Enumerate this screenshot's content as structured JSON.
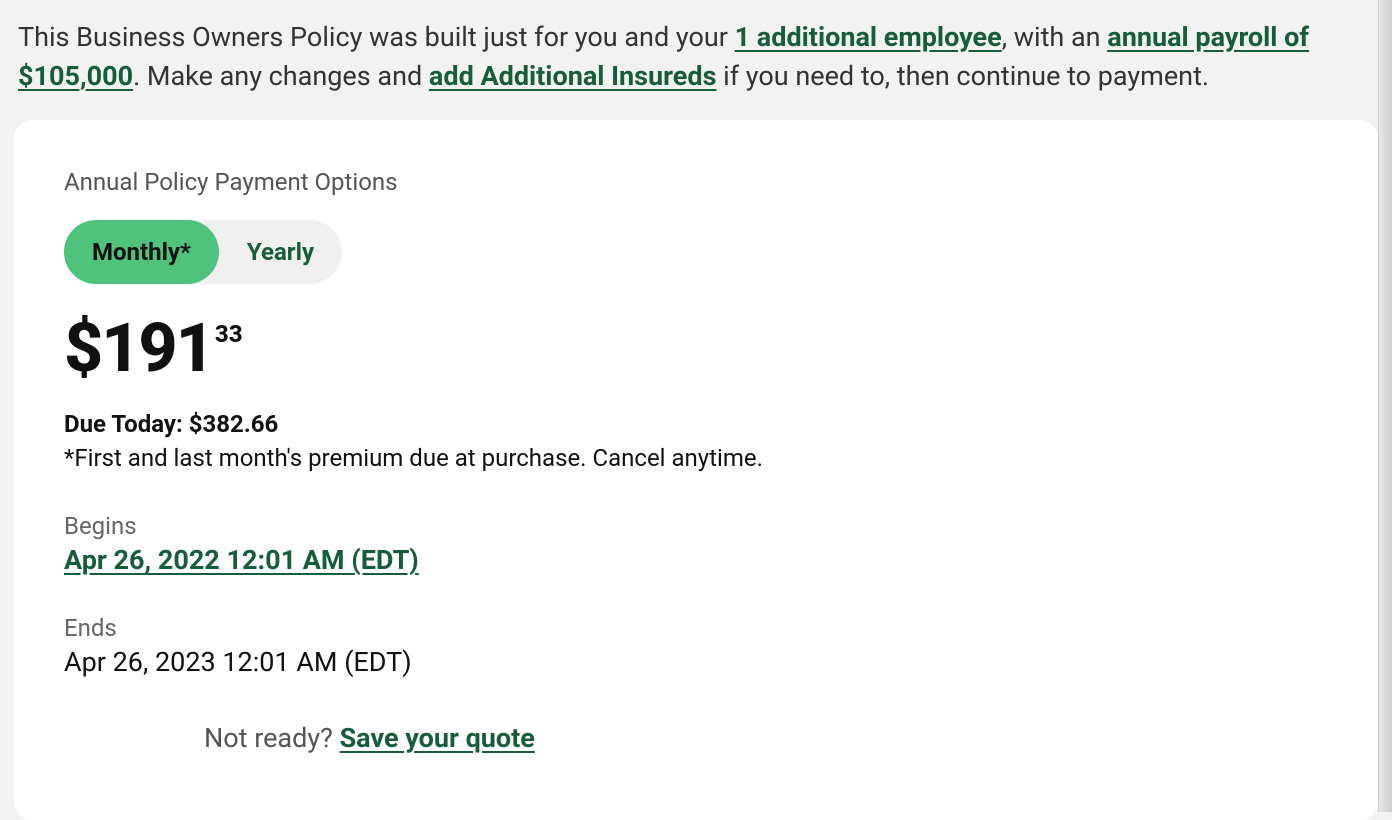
{
  "intro": {
    "prefix": "This Business Owners Policy was built just for you and your ",
    "employees_link": "1 additional employee",
    "mid1": ", with an ",
    "payroll_link": "annual payroll of $105,000",
    "mid2": ". Make any changes and ",
    "additional_insureds_link": "add Additional Insureds",
    "suffix": " if you need to, then continue to payment."
  },
  "payment": {
    "section_label": "Annual Policy Payment Options",
    "tab_monthly": "Monthly*",
    "tab_yearly": "Yearly",
    "price_dollars": "$191",
    "price_cents": "33",
    "due_today_label": "Due Today: ",
    "due_today_amount": "$382.66",
    "disclaimer": "*First and last month's premium due at purchase. Cancel anytime.",
    "begins_label": "Begins",
    "begins_value": "Apr 26, 2022 12:01 AM (EDT)",
    "ends_label": "Ends",
    "ends_value": "Apr 26, 2023 12:01 AM (EDT)",
    "save_prefix": "Not ready? ",
    "save_link": "Save your quote"
  }
}
